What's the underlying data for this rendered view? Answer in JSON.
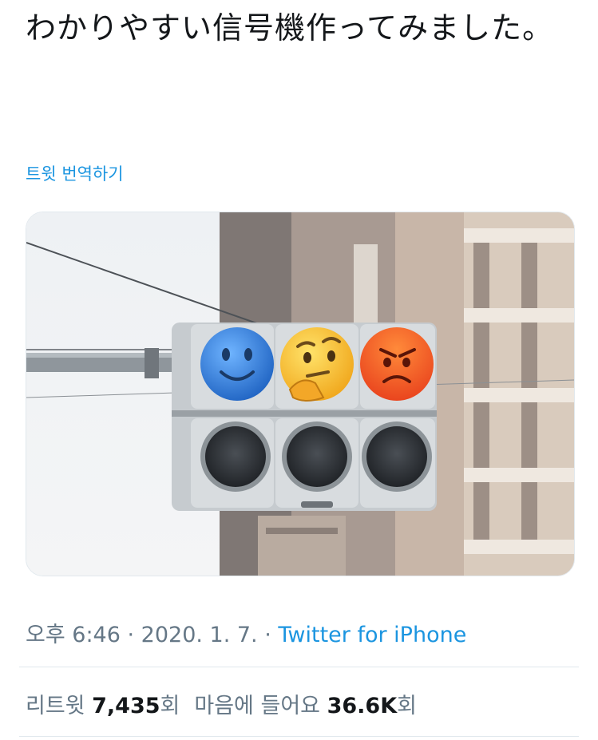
{
  "tweet": {
    "text": "わかりやすい信号機作ってみました。",
    "translate_label": "트윗 번역하기"
  },
  "media": {
    "icons": [
      "blue-smiling-face-icon",
      "thinking-face-icon",
      "angry-face-icon"
    ],
    "colors": {
      "blue_face": "#2f7fd8",
      "yellow_face": "#f6c530",
      "red_face": "#f05a23"
    }
  },
  "meta": {
    "time": "오후 6:46",
    "sep1": " · ",
    "date": "2020. 1. 7.",
    "sep2": " · ",
    "source": "Twitter for iPhone"
  },
  "stats": {
    "retweets_label": "리트윗",
    "retweets_count": "7,435",
    "retweets_unit": "회",
    "likes_label": "마음에 들어요",
    "likes_count": "36.6K",
    "likes_unit": "회"
  },
  "colors": {
    "link": "#1b95e0",
    "muted": "#657786",
    "text": "#14171a"
  }
}
